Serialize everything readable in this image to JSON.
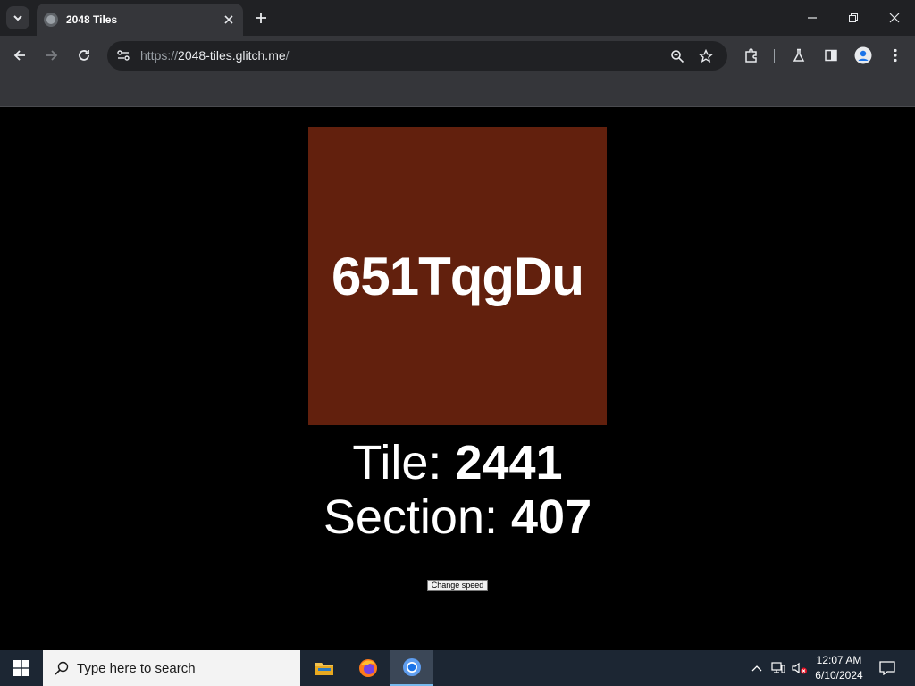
{
  "browser": {
    "tab": {
      "title": "2048 Tiles"
    },
    "url": {
      "scheme": "https://",
      "host": "2048-tiles.glitch.me",
      "path": "/"
    }
  },
  "page": {
    "tile_code": "651TqgDu",
    "tile_color": "#62200d",
    "tile_label": "Tile: ",
    "tile_value": "2441",
    "section_label": "Section: ",
    "section_value": "407",
    "speed_button": "Change speed"
  },
  "taskbar": {
    "search_placeholder": "Type here to search",
    "time": "12:07 AM",
    "date": "6/10/2024"
  }
}
